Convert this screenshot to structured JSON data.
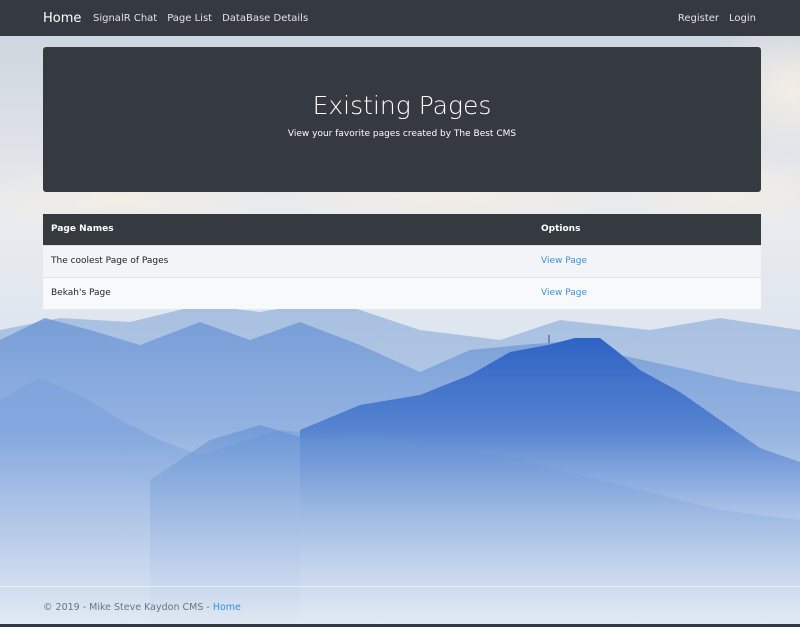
{
  "navbar": {
    "brand": "Home",
    "left_links": [
      "SignalR Chat",
      "Page List",
      "DataBase Details"
    ],
    "right_links": [
      "Register",
      "Login"
    ]
  },
  "jumbotron": {
    "title": "Existing Pages",
    "subtitle": "View your favorite pages created by The Best CMS"
  },
  "table": {
    "headers": [
      "Page Names",
      "Options"
    ],
    "rows": [
      {
        "name": "The coolest Page of Pages",
        "action": "View Page"
      },
      {
        "name": "Bekah's Page",
        "action": "View Page"
      }
    ]
  },
  "footer": {
    "text": "© 2019 - Mike Steve Kaydon CMS - ",
    "link": "Home"
  },
  "colors": {
    "navbar": "#343a40",
    "link": "#3b8fd9",
    "sky": "#e4e9ef",
    "mountains": "#4f7fca"
  },
  "background": {
    "scene": "mountains-landscape"
  }
}
